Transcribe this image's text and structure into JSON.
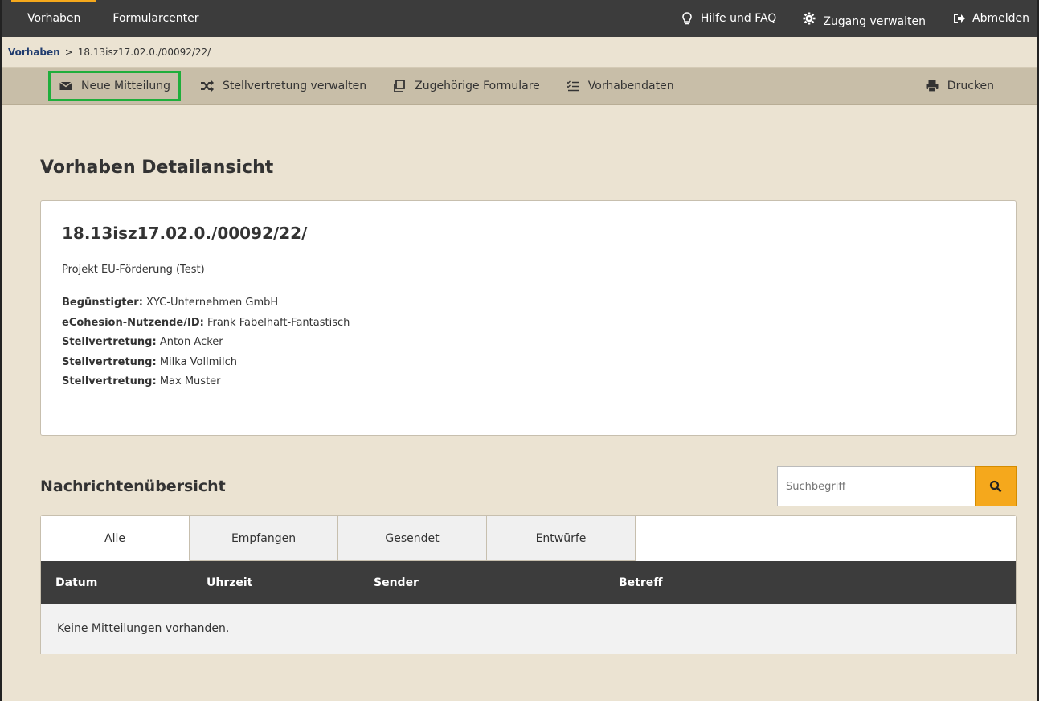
{
  "topnav": {
    "items": [
      {
        "label": "Vorhaben",
        "active": true
      },
      {
        "label": "Formularcenter",
        "active": false
      }
    ],
    "help_label": "Hilfe und FAQ",
    "access_label": "Zugang verwalten",
    "logout_label": "Abmelden",
    "accent_color": "#f5a81c"
  },
  "breadcrumb": {
    "root": "Vorhaben",
    "separator": ">",
    "current": "18.13isz17.02.0./00092/22/"
  },
  "actions": {
    "new_message": "Neue Mitteilung",
    "manage_substitution": "Stellvertretung verwalten",
    "related_forms": "Zugehörige Formulare",
    "project_data": "Vorhabendaten",
    "print": "Drucken",
    "highlight_color": "#1fae3b"
  },
  "page": {
    "title": "Vorhaben Detailansicht"
  },
  "detail": {
    "id": "18.13isz17.02.0./00092/22/",
    "subtitle": "Projekt EU-Förderung (Test)",
    "fields": [
      {
        "label": "Begünstigter:",
        "value": "XYC-Unternehmen GmbH"
      },
      {
        "label": "eCohesion-Nutzende/ID:",
        "value": "Frank Fabelhaft-Fantastisch"
      },
      {
        "label": "Stellvertretung:",
        "value": "Anton Acker"
      },
      {
        "label": "Stellvertretung:",
        "value": "Milka Vollmilch"
      },
      {
        "label": "Stellvertretung:",
        "value": "Max Muster"
      }
    ]
  },
  "messages": {
    "title": "Nachrichtenübersicht",
    "search_placeholder": "Suchbegriff",
    "tabs": [
      "Alle",
      "Empfangen",
      "Gesendet",
      "Entwürfe"
    ],
    "active_tab": "Alle",
    "columns": [
      "Datum",
      "Uhrzeit",
      "Sender",
      "Betreff"
    ],
    "empty_text": "Keine Mitteilungen vorhanden."
  }
}
